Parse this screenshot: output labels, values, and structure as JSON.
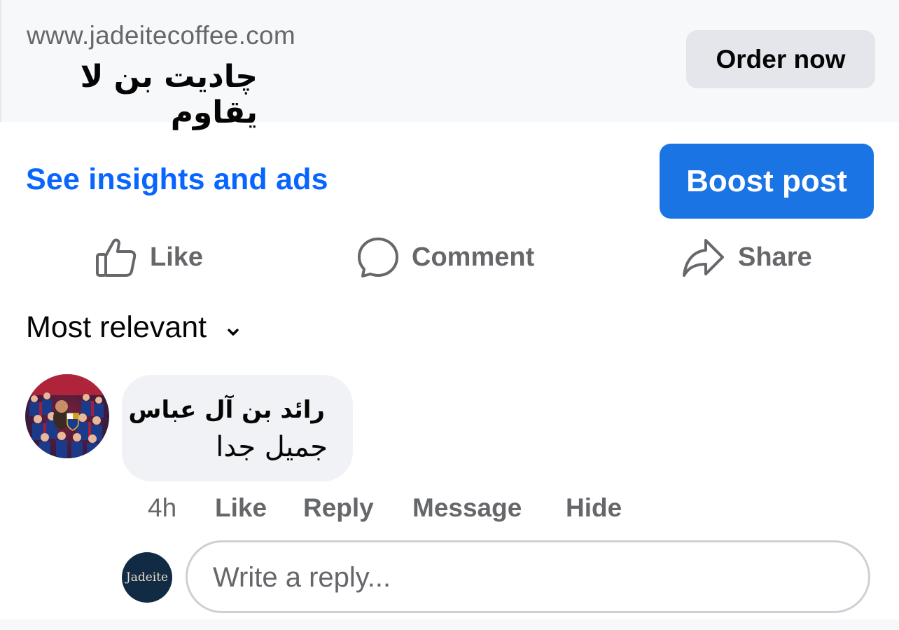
{
  "ad": {
    "url": "www.jadeitecoffee.com",
    "headline": "چاديت بن لا يقاوم",
    "cta_label": "Order now"
  },
  "post_tools": {
    "insights_label": "See insights and ads",
    "boost_label": "Boost post"
  },
  "actions": {
    "like": "Like",
    "comment": "Comment",
    "share": "Share",
    "icons": [
      "thumbs-up-icon",
      "comment-bubble-icon",
      "share-arrow-icon"
    ]
  },
  "comments_sort": {
    "label": "Most relevant"
  },
  "comment": {
    "author": "رائد بن آل عباس",
    "text": "جميل جدا",
    "time": "4h",
    "like": "Like",
    "reply": "Reply",
    "message": "Message",
    "hide": "Hide"
  },
  "reply_box": {
    "placeholder": "Write a reply...",
    "page_avatar_text": "Jadeite"
  },
  "colors": {
    "brand_blue": "#1b74e4",
    "link_blue": "#0866ff",
    "secondary_text": "#65676b",
    "bubble_bg": "#f0f2f5"
  }
}
